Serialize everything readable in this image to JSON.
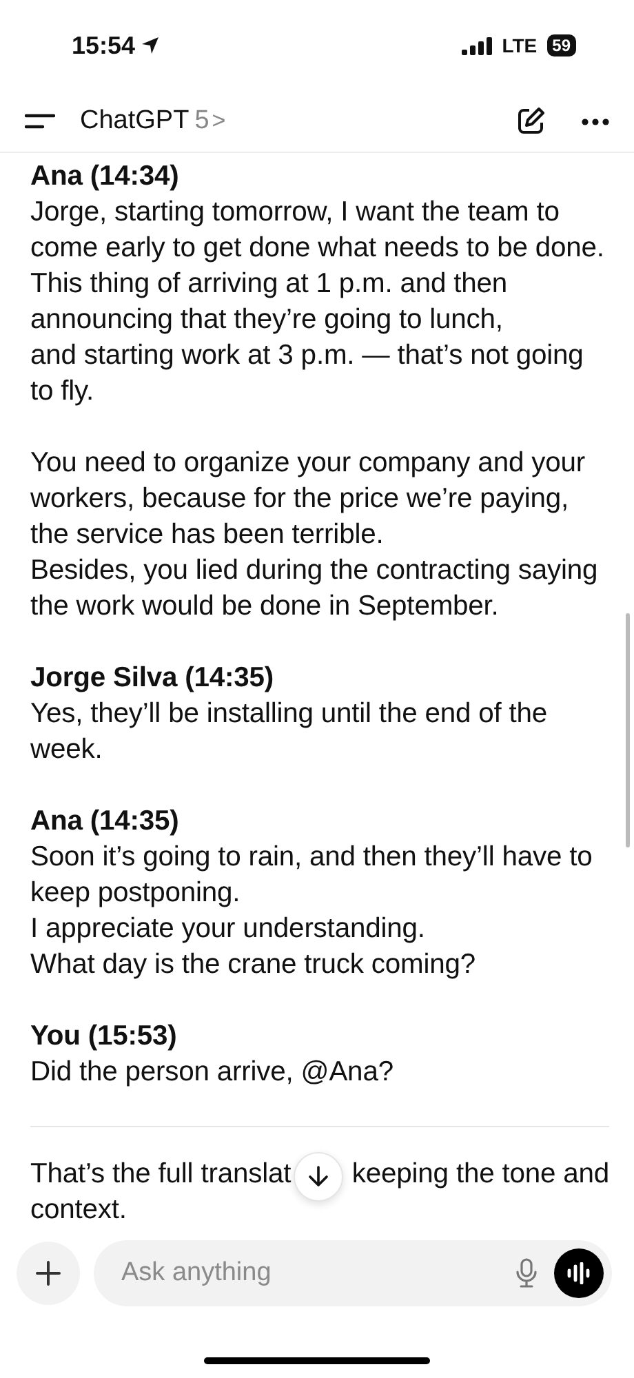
{
  "status_bar": {
    "time": "15:54",
    "network": "LTE",
    "battery": "59"
  },
  "header": {
    "title": "ChatGPT",
    "model": "5",
    "chevron": ">"
  },
  "messages": [
    {
      "author": "Ana (14:34)",
      "paragraphs": [
        "Jorge, starting tomorrow, I want the team to come early to get done what needs to be done. This thing of arriving at 1 p.m. and then announcing that they’re going to lunch,\nand starting work at 3 p.m. — that’s not going to fly.",
        "You need to organize your company and your workers, because for the price we’re paying, the service has been terrible.\nBesides, you lied during the contracting saying the work would be done in September."
      ]
    },
    {
      "author": "Jorge Silva (14:35)",
      "paragraphs": [
        "Yes, they’ll be installing until the end of the week."
      ]
    },
    {
      "author": "Ana (14:35)",
      "paragraphs": [
        "Soon it’s going to rain, and then they’ll have to keep postponing.\nI appreciate your understanding.\nWhat day is the crane truck coming?"
      ]
    },
    {
      "author": "You (15:53)",
      "paragraphs": [
        "Did the person arrive, @Ana?"
      ]
    }
  ],
  "closing": {
    "line_1_start": "That’s the full translat",
    "line_1_end": "keeping the tone and",
    "line_2": "context."
  },
  "composer": {
    "placeholder": "Ask anything"
  }
}
